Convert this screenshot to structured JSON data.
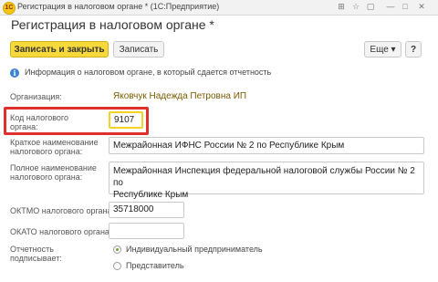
{
  "window": {
    "logo_text": "1С",
    "title": "Регистрация в налоговом органе * (1С:Предприятие)",
    "controls": [
      "⊞",
      "☆",
      "▢",
      "—",
      "□",
      "✕"
    ]
  },
  "form": {
    "title": "Регистрация в налоговом органе *"
  },
  "toolbar": {
    "save_close_label": "Записать и закрыть",
    "save_label": "Записать",
    "more_label": "Еще ▾",
    "help_label": "?"
  },
  "info": {
    "icon": "i",
    "text": "Информация о налоговом органе, в который сдается отчетность"
  },
  "fields": {
    "organization": {
      "label": "Организация:",
      "value": "Яковчук Надежда Петровна ИП"
    },
    "tax_code": {
      "label_line1": "Код налогового",
      "label_line2": "органа:",
      "value": "9107"
    },
    "short_name": {
      "label_line1": "Краткое наименование",
      "label_line2": "налогового органа:",
      "value": "Межрайонная ИФНС России № 2 по Республике Крым"
    },
    "full_name": {
      "label_line1": "Полное наименование",
      "label_line2": "налогового органа:",
      "value_line1": "Межрайонная Инспекция федеральной налоговой службы России № 2 по",
      "value_line2": "Республике Крым"
    },
    "oktmo": {
      "label": "ОКТМО налогового органа:",
      "value": "35718000"
    },
    "okato": {
      "label": "ОКАТО налогового органа:",
      "value": ""
    },
    "reporting_signer": {
      "label_line1": "Отчетность",
      "label_line2": "подписывает:",
      "options": [
        "Индивидуальный предприниматель",
        "Представитель"
      ],
      "selected": "Индивидуальный предприниматель"
    }
  },
  "colors": {
    "primary_button": "#f8d93b",
    "highlight_border": "#e0302b",
    "org_link": "#7a5a00"
  }
}
